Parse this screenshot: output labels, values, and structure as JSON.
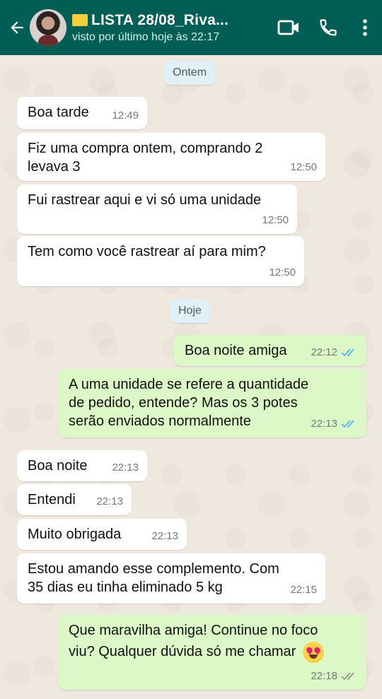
{
  "header": {
    "title": "LISTA  28/08_Riva...",
    "last_seen": "visto por último hoje às 22:17",
    "bg_color": "#005e54",
    "icons": [
      "back-arrow-icon",
      "avatar",
      "video-call-icon",
      "phone-icon",
      "more-options-icon"
    ]
  },
  "chat": {
    "date_yesterday": "Ontem",
    "date_today": "Hoje",
    "messages": [
      {
        "text": "Boa tarde",
        "time": "12:49",
        "dir": "in"
      },
      {
        "text1": "Fiz uma compra ontem, comprando 2",
        "text2": "levava 3",
        "time": "12:50",
        "dir": "in"
      },
      {
        "text": "Fui rastrear aqui e vi só uma unidade",
        "time": "12:50",
        "dir": "in"
      },
      {
        "text": "Tem como você rastrear aí para mim?",
        "time": "12:50",
        "dir": "in"
      },
      {
        "text": "Boa noite amiga",
        "time": "22:12",
        "dir": "out",
        "status": "read"
      },
      {
        "text1": "A uma unidade se refere a quantidade",
        "text2": "de pedido, entende? Mas os 3 potes",
        "text3": "serão enviados normalmente",
        "time": "22:13",
        "dir": "out",
        "status": "read"
      },
      {
        "text": "Boa noite",
        "time": "22:13",
        "dir": "in"
      },
      {
        "text": "Entendi",
        "time": "22:13",
        "dir": "in"
      },
      {
        "text": "Muito obrigada",
        "time": "22:13",
        "dir": "in"
      },
      {
        "text1": "Estou amando esse complemento. Com",
        "text2": "35 dias eu tinha eliminado 5 kg",
        "time": "22:15",
        "dir": "in"
      },
      {
        "text1": "Que maravilha amiga! Continue no foco",
        "text2": "viu? Qualquer dúvida só me chamar",
        "emoji": "heart-eyes-emoji",
        "time": "22:18",
        "dir": "out",
        "status": "delivered"
      }
    ],
    "colors": {
      "incoming": "#ffffff",
      "outgoing": "#dcf8c6",
      "read_ticks": "#4fb6ec",
      "delivered_ticks": "#8c968e"
    }
  }
}
